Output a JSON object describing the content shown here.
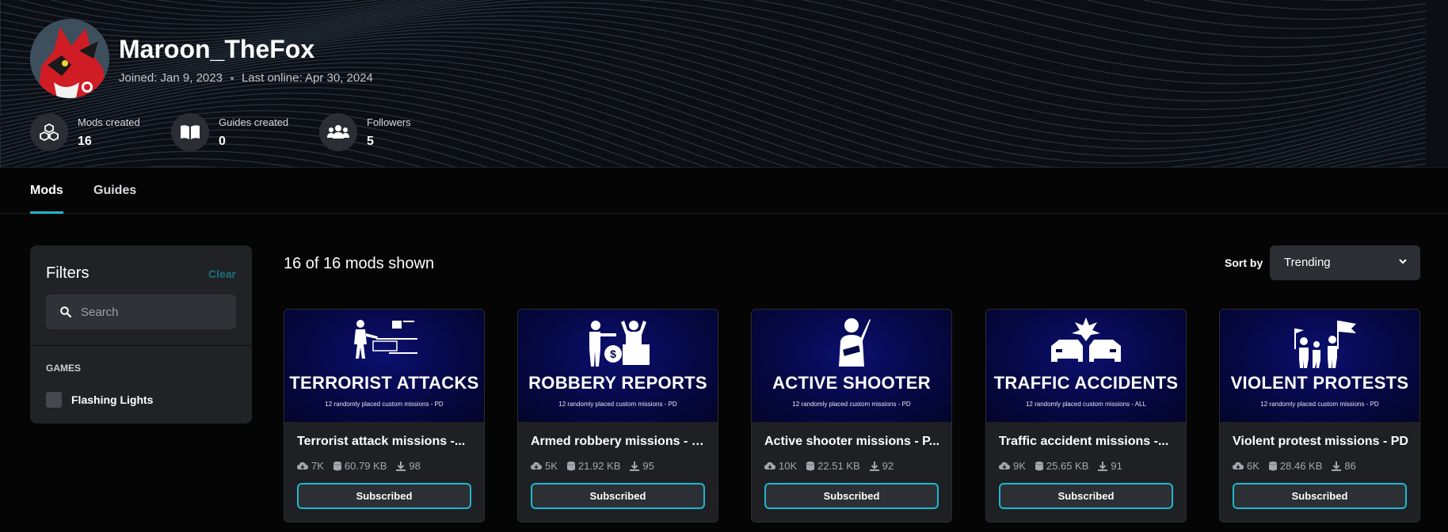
{
  "profile": {
    "username": "Maroon_TheFox",
    "joined": "Joined: Jan 9, 2023",
    "last_online": "Last online: Apr 30, 2024",
    "stats": [
      {
        "label": "Mods created",
        "value": "16",
        "icon": "cubes-icon"
      },
      {
        "label": "Guides created",
        "value": "0",
        "icon": "book-icon"
      },
      {
        "label": "Followers",
        "value": "5",
        "icon": "users-icon"
      }
    ]
  },
  "tabs": [
    {
      "label": "Mods",
      "active": true
    },
    {
      "label": "Guides",
      "active": false
    }
  ],
  "filters": {
    "title": "Filters",
    "clear_label": "Clear",
    "search_placeholder": "Search",
    "games_heading": "GAMES",
    "games": [
      {
        "label": "Flashing Lights",
        "checked": false
      }
    ]
  },
  "listing": {
    "count_text": "16 of 16 mods shown",
    "sort_label": "Sort by",
    "sort_value": "Trending"
  },
  "cards": [
    {
      "thumb_title": "TERRORIST ATTACKS",
      "thumb_sub": "12 randomly placed custom missions - PD",
      "name": "Terrorist attack missions -...",
      "downloads": "7K",
      "size": "60.79 KB",
      "subs": "98",
      "button": "Subscribed",
      "icon": "terrorist-icon"
    },
    {
      "thumb_title": "ROBBERY REPORTS",
      "thumb_sub": "12 randomly placed custom missions - PD",
      "name": "Armed robbery missions - PD",
      "downloads": "5K",
      "size": "21.92 KB",
      "subs": "95",
      "button": "Subscribed",
      "icon": "robbery-icon"
    },
    {
      "thumb_title": "ACTIVE SHOOTER",
      "thumb_sub": "12 randomly placed custom missions - PD",
      "name": "Active shooter missions - P...",
      "downloads": "10K",
      "size": "22.51 KB",
      "subs": "92",
      "button": "Subscribed",
      "icon": "shooter-icon"
    },
    {
      "thumb_title": "TRAFFIC ACCIDENTS",
      "thumb_sub": "12 randomly placed custom missions - ALL",
      "name": "Traffic accident missions -...",
      "downloads": "9K",
      "size": "25.65 KB",
      "subs": "91",
      "button": "Subscribed",
      "icon": "car-crash-icon"
    },
    {
      "thumb_title": "VIOLENT PROTESTS",
      "thumb_sub": "12 randomly placed custom missions - PD",
      "name": "Violent protest missions - PD",
      "downloads": "6K",
      "size": "28.46 KB",
      "subs": "86",
      "button": "Subscribed",
      "icon": "protest-icon"
    }
  ],
  "colors": {
    "accent": "#1fb6d0",
    "background": "#050505",
    "card": "#1e2024",
    "thumb": "#060845"
  }
}
